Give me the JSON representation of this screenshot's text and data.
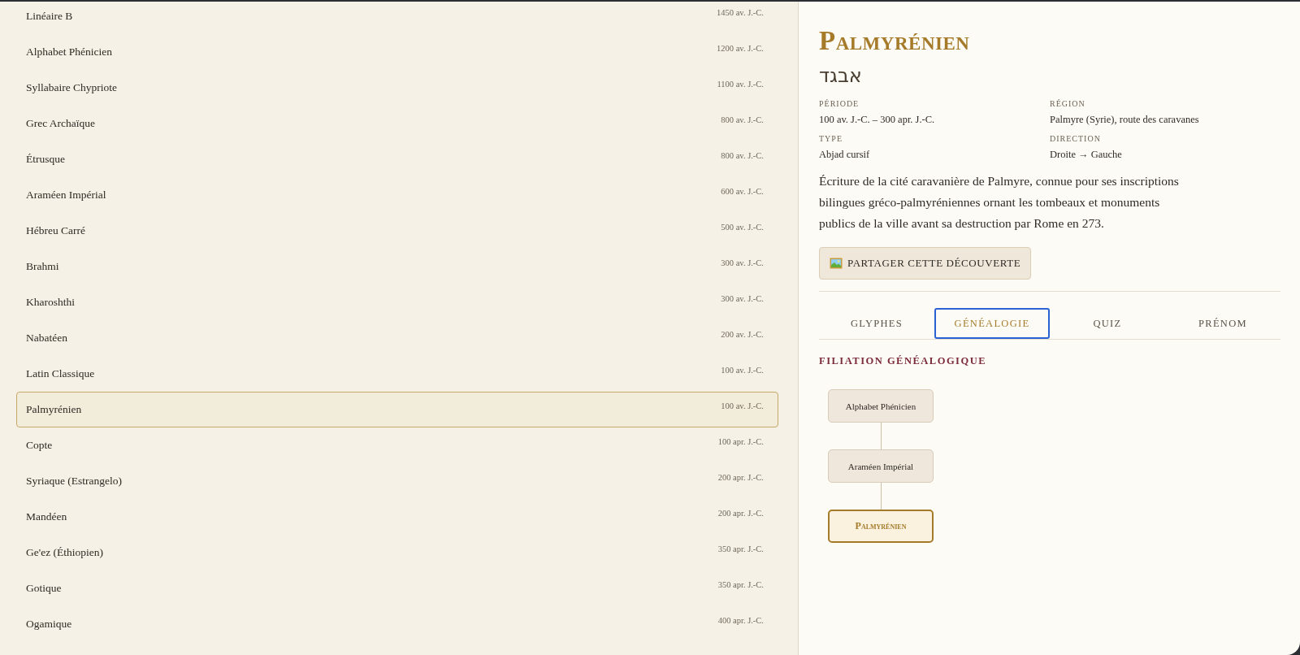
{
  "scripts": [
    {
      "name": "Linéaire B",
      "date": "1450 av. J.-C.",
      "selected": false
    },
    {
      "name": "Alphabet Phénicien",
      "date": "1200 av. J.-C.",
      "selected": false
    },
    {
      "name": "Syllabaire Chypriote",
      "date": "1100 av. J.-C.",
      "selected": false
    },
    {
      "name": "Grec Archaïque",
      "date": "800 av. J.-C.",
      "selected": false
    },
    {
      "name": "Étrusque",
      "date": "800 av. J.-C.",
      "selected": false
    },
    {
      "name": "Araméen Impérial",
      "date": "600 av. J.-C.",
      "selected": false
    },
    {
      "name": "Hébreu Carré",
      "date": "500 av. J.-C.",
      "selected": false
    },
    {
      "name": "Brahmi",
      "date": "300 av. J.-C.",
      "selected": false
    },
    {
      "name": "Kharoshthi",
      "date": "300 av. J.-C.",
      "selected": false
    },
    {
      "name": "Nabatéen",
      "date": "200 av. J.-C.",
      "selected": false
    },
    {
      "name": "Latin Classique",
      "date": "100 av. J.-C.",
      "selected": false
    },
    {
      "name": "Palmyrénien",
      "date": "100 av. J.-C.",
      "selected": true
    },
    {
      "name": "Copte",
      "date": "100 apr. J.-C.",
      "selected": false
    },
    {
      "name": "Syriaque (Estrangelo)",
      "date": "200 apr. J.-C.",
      "selected": false
    },
    {
      "name": "Mandéen",
      "date": "200 apr. J.-C.",
      "selected": false
    },
    {
      "name": "Ge'ez (Éthiopien)",
      "date": "350 apr. J.-C.",
      "selected": false
    },
    {
      "name": "Gotique",
      "date": "350 apr. J.-C.",
      "selected": false
    },
    {
      "name": "Ogamique",
      "date": "400 apr. J.-C.",
      "selected": false
    }
  ],
  "detail": {
    "title": "Palmyrénien",
    "glyphs": "אבגד",
    "facts": [
      {
        "label": "PÉRIODE",
        "value": "100 av. J.-C. – 300 apr. J.-C."
      },
      {
        "label": "RÉGION",
        "value": "Palmyre (Syrie), route des caravanes"
      },
      {
        "label": "TYPE",
        "value": "Abjad cursif"
      },
      {
        "label": "DIRECTION",
        "value": "Droite → Gauche"
      }
    ],
    "description": "Écriture de la cité caravanière de Palmyre, connue pour ses inscriptions bilingues gréco-palmyréniennes ornant les tombeaux et monuments publics de la ville avant sa destruction par Rome en 273.",
    "share_button": "PARTAGER CETTE DÉCOUVERTE",
    "tabs": [
      {
        "label": "GLYPHES",
        "selected": false
      },
      {
        "label": "GÉNÉALOGIE",
        "selected": true
      },
      {
        "label": "QUIZ",
        "selected": false
      },
      {
        "label": "PRÉNOM",
        "selected": false
      }
    ],
    "section_title": "FILIATION GÉNÉALOGIQUE",
    "lineage": [
      {
        "name": "Alphabet Phénicien",
        "current": false
      },
      {
        "name": "Araméen Impérial",
        "current": false
      },
      {
        "name": "Palmyrénien",
        "current": true
      }
    ]
  }
}
